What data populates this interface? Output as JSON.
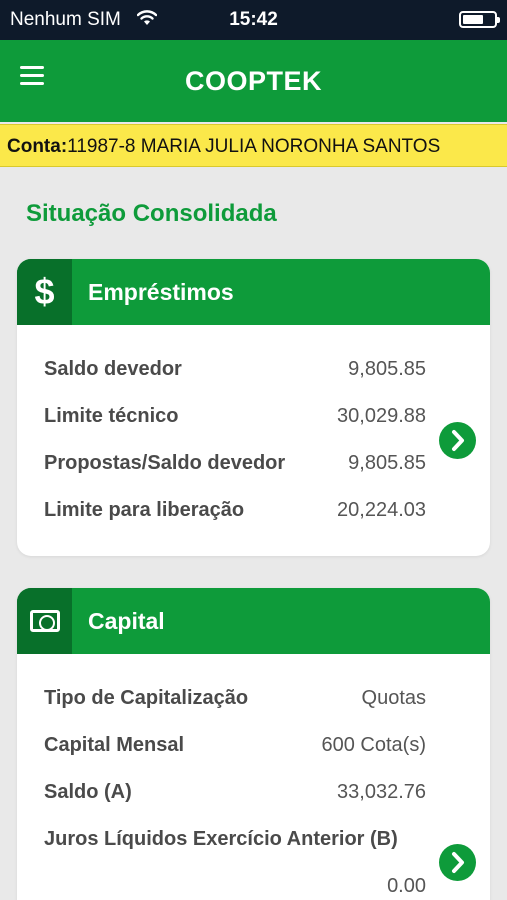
{
  "status_bar": {
    "carrier": "Nenhum SIM",
    "time": "15:42"
  },
  "header": {
    "title": "COOPTEK"
  },
  "account": {
    "label": "Conta:",
    "value": "11987-8 MARIA JULIA NORONHA SANTOS"
  },
  "section_title": "Situação Consolidada",
  "emprestimos": {
    "title": "Empréstimos",
    "icon": "dollar-icon",
    "rows": [
      {
        "label": "Saldo devedor",
        "value": "9,805.85"
      },
      {
        "label": "Limite técnico",
        "value": "30,029.88"
      },
      {
        "label": "Propostas/Saldo devedor",
        "value": "9,805.85"
      },
      {
        "label": "Limite para liberação",
        "value": "20,224.03"
      }
    ]
  },
  "capital": {
    "title": "Capital",
    "icon": "banknote-icon",
    "rows": [
      {
        "label": "Tipo de Capitalização",
        "value": "Quotas"
      },
      {
        "label": "Capital Mensal",
        "value": "600 Cota(s)"
      },
      {
        "label": "Saldo (A)",
        "value": "33,032.76"
      },
      {
        "label": "Juros Líquidos Exercício Anterior (B)",
        "value": "0.00"
      }
    ]
  },
  "colors": {
    "primary_green": "#0e9b3a",
    "dark_green": "#08702a",
    "account_bar": "#fbe84a",
    "status_bar": "#0e1a2a"
  }
}
